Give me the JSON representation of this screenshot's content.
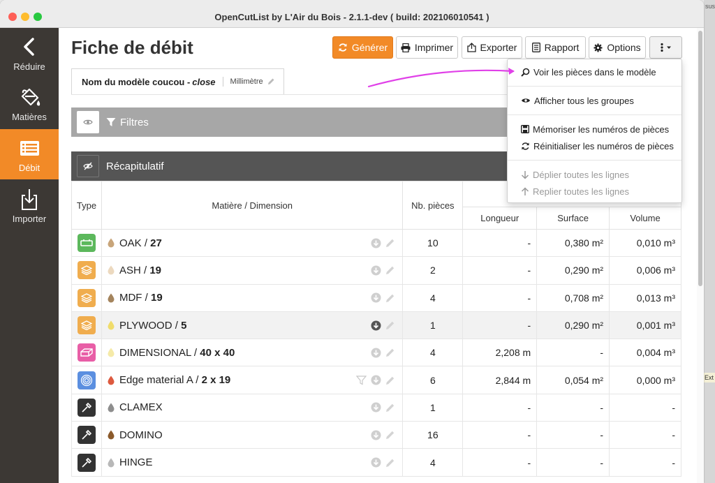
{
  "window": {
    "title": "OpenCutList by L'Air du Bois - 2.1.1-dev ( build: 202106010541 )"
  },
  "background": {
    "frag1": "sus",
    "frag2": "Ext"
  },
  "sidebar": {
    "items": [
      {
        "label": "Réduire",
        "icon": "chevron-left-icon"
      },
      {
        "label": "Matières",
        "icon": "paint-bucket-icon"
      },
      {
        "label": "Débit",
        "icon": "list-icon",
        "active": true
      },
      {
        "label": "Importer",
        "icon": "import-icon"
      }
    ]
  },
  "page": {
    "title": "Fiche de débit"
  },
  "toolbar": {
    "generate": "Générer",
    "print": "Imprimer",
    "export": "Exporter",
    "report": "Rapport",
    "options": "Options"
  },
  "tab": {
    "model_prefix": "Nom du modèle coucou - ",
    "model_suffix": "close",
    "unit": "Millimètre"
  },
  "filters": {
    "title": "Filtres"
  },
  "recap": {
    "title": "Récapitulatif",
    "headers": {
      "type": "Type",
      "material": "Matière / Dimension",
      "count": "Nb. pièces",
      "length": "Longueur",
      "surface": "Surface",
      "volume": "Volume"
    },
    "rows": [
      {
        "name": "OAK",
        "dim": "27",
        "count": "10",
        "length": "-",
        "surface": "0,380 m²",
        "volume": "0,010 m³"
      },
      {
        "name": "ASH",
        "dim": "19",
        "count": "2",
        "length": "-",
        "surface": "0,290 m²",
        "volume": "0,006 m³"
      },
      {
        "name": "MDF",
        "dim": "19",
        "count": "4",
        "length": "-",
        "surface": "0,708 m²",
        "volume": "0,013 m³"
      },
      {
        "name": "PLYWOOD",
        "dim": "5",
        "count": "1",
        "length": "-",
        "surface": "0,290 m²",
        "volume": "0,001 m³"
      },
      {
        "name": "DIMENSIONAL",
        "dim": "40 x 40",
        "count": "4",
        "length": "2,208 m",
        "surface": "-",
        "volume": "0,004 m³"
      },
      {
        "name": "Edge material A",
        "dim": "2 x 19",
        "count": "6",
        "length": "2,844 m",
        "surface": "0,054 m²",
        "volume": "0,000 m³"
      },
      {
        "name": "CLAMEX",
        "dim": "",
        "count": "1",
        "length": "-",
        "surface": "-",
        "volume": "-"
      },
      {
        "name": "DOMINO",
        "dim": "",
        "count": "16",
        "length": "-",
        "surface": "-",
        "volume": "-"
      },
      {
        "name": "HINGE",
        "dim": "",
        "count": "4",
        "length": "-",
        "surface": "-",
        "volume": "-"
      }
    ]
  },
  "dropdown": {
    "items": [
      {
        "label": "Voir les pièces dans le modèle",
        "icon": "search-icon"
      },
      {
        "label": "Afficher tous les groupes",
        "icon": "eye-icon"
      },
      {
        "label": "Mémoriser les numéros de pièces",
        "icon": "save-icon"
      },
      {
        "label": "Réinitialiser les numéros de pièces",
        "icon": "refresh-icon"
      },
      {
        "label": "Déplier toutes les lignes",
        "icon": "arrow-down-icon",
        "disabled": true
      },
      {
        "label": "Replier toutes les lignes",
        "icon": "arrow-up-icon",
        "disabled": true
      }
    ]
  },
  "colors": {
    "accent": "#f28a27",
    "sidebar": "#3c3834",
    "annotation_arrow": "#e040e8"
  }
}
